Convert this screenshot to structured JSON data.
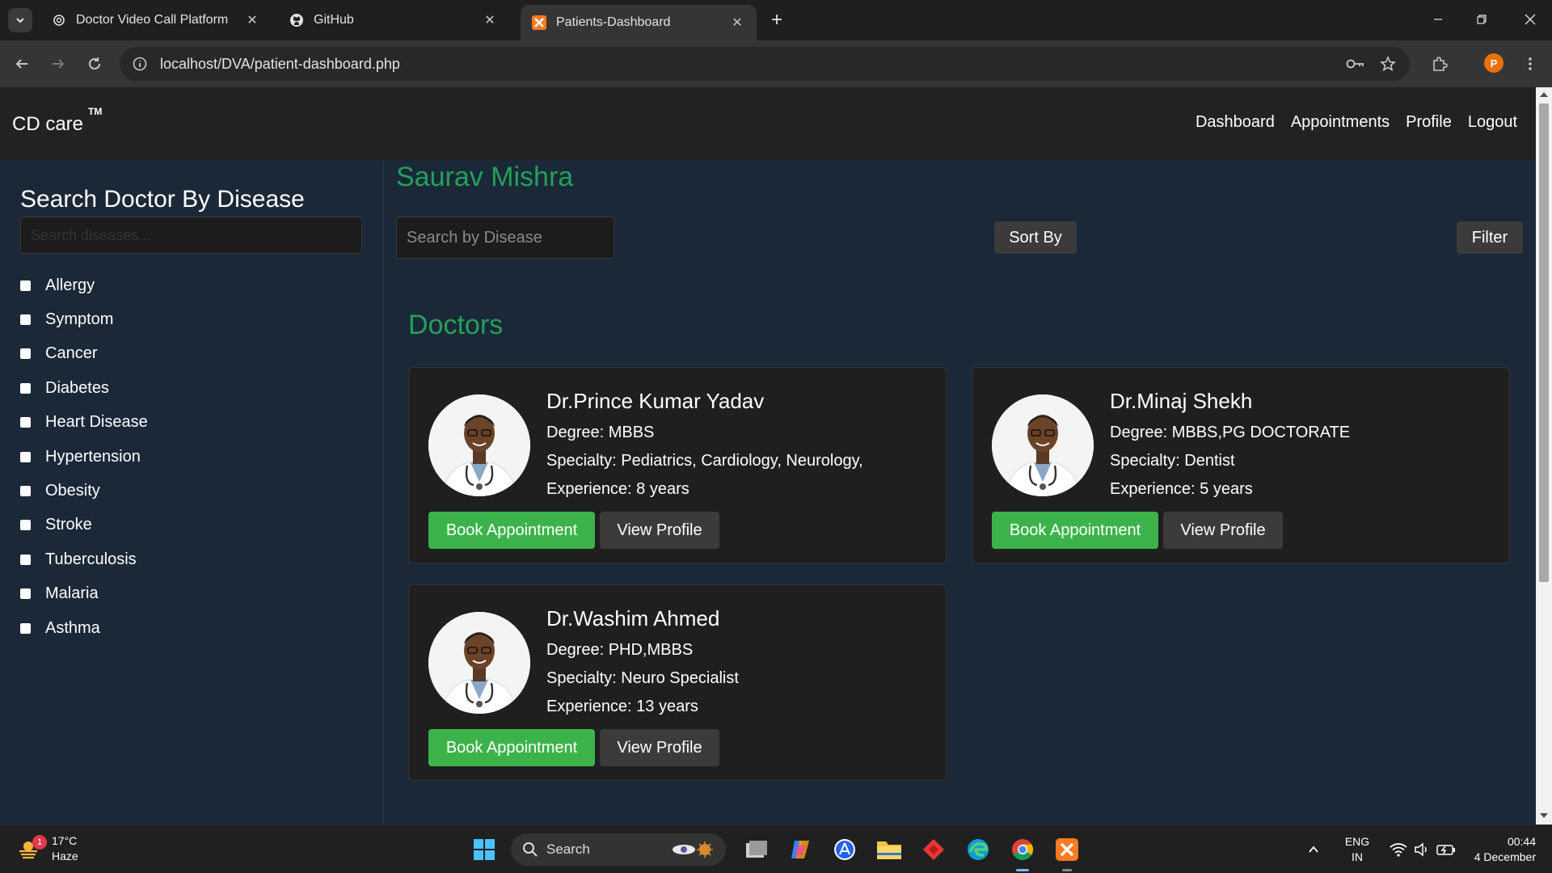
{
  "browser": {
    "tabs": [
      {
        "title": "Doctor Video Call Platform"
      },
      {
        "title": "GitHub"
      },
      {
        "title": "Patients-Dashboard"
      }
    ],
    "url": "localhost/DVA/patient-dashboard.php",
    "profile_initial": "P"
  },
  "navbar": {
    "brand": "CD care",
    "brand_mark": "TM",
    "links": [
      "Dashboard",
      "Appointments",
      "Profile",
      "Logout"
    ]
  },
  "sidebar": {
    "title": "Search Doctor By Disease",
    "search_placeholder": "Search diseases...",
    "diseases": [
      "Allergy",
      "Symptom",
      "Cancer",
      "Diabetes",
      "Heart Disease",
      "Hypertension",
      "Obesity",
      "Stroke",
      "Tuberculosis",
      "Malaria",
      "Asthma"
    ]
  },
  "main": {
    "user_name": "Saurav Mishra",
    "search_placeholder": "Search by Disease",
    "sort_label": "Sort By",
    "filter_label": "Filter",
    "section_title": "Doctors",
    "doctors": [
      {
        "name": "Dr.Prince Kumar Yadav",
        "degree": "Degree: MBBS",
        "specialty": "Specialty: Pediatrics, Cardiology, Neurology,",
        "experience": "Experience: 8 years"
      },
      {
        "name": "Dr.Minaj Shekh",
        "degree": "Degree: MBBS,PG DOCTORATE",
        "specialty": "Specialty: Dentist",
        "experience": "Experience: 5 years"
      },
      {
        "name": "Dr.Washim Ahmed",
        "degree": "Degree: PHD,MBBS",
        "specialty": "Specialty: Neuro Specialist",
        "experience": "Experience: 13 years"
      }
    ],
    "book_label": "Book Appointment",
    "view_label": "View Profile"
  },
  "taskbar": {
    "weather_temp": "17°C",
    "weather_desc": "Haze",
    "weather_badge": "1",
    "search_label": "Search",
    "lang_top": "ENG",
    "lang_bottom": "IN",
    "time": "00:44",
    "date": "4 December"
  },
  "colors": {
    "page_bg": "#1b2838",
    "accent_green": "#22a05a",
    "button_green": "#3cb34a",
    "navbar_bg": "#222222"
  }
}
